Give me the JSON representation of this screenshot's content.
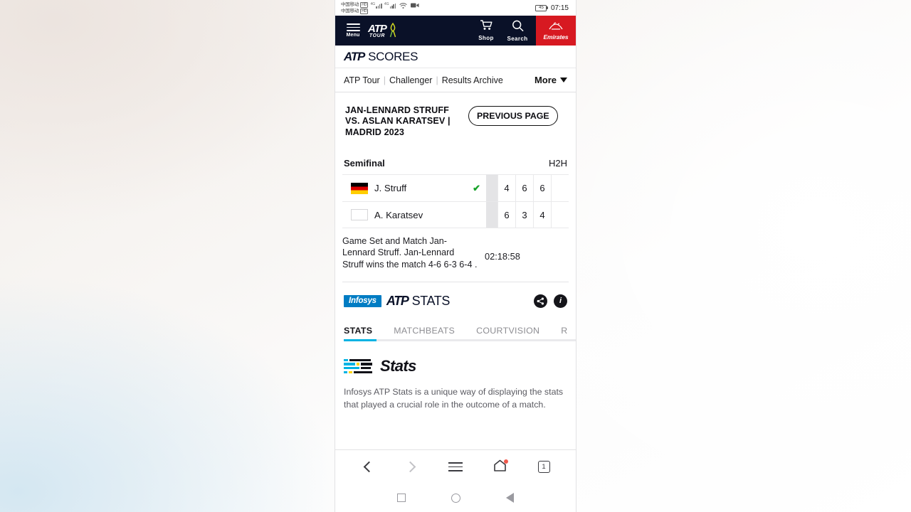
{
  "status_bar": {
    "carrier_line1": "中国移动",
    "carrier_line2": "中国移动",
    "hd_badge_1": "HD",
    "hd_badge_2": "HD",
    "network_1": "4G",
    "network_2": "4G",
    "wifi_icon": "wifi-icon",
    "video_icon": "video-camera-icon",
    "battery_level": "45",
    "clock": "07:15"
  },
  "top_nav": {
    "menu_label": "Menu",
    "logo_main": "ATP",
    "logo_sub": "TOUR",
    "ribbon_icon": "ribbon-icon",
    "shop_label": "Shop",
    "shop_icon": "cart-icon",
    "search_label": "Search",
    "search_icon": "search-icon",
    "sponsor_label": "Emirates",
    "sponsor_arabic": "طيران",
    "sponsor_color": "#d71921",
    "nav_bg": "#0a1128"
  },
  "scores_header": {
    "brand": "ATP",
    "title": "SCORES"
  },
  "sub_nav": {
    "items": [
      {
        "label": "ATP Tour"
      },
      {
        "label": "Challenger"
      },
      {
        "label": "Results Archive"
      }
    ],
    "separator": "|",
    "more_label": "More",
    "more_icon": "chevron-down-icon"
  },
  "match_header": {
    "title": "JAN-LENNARD STRUFF VS. ASLAN KARATSEV | MADRID 2023",
    "previous_page_label": "PREVIOUS PAGE"
  },
  "scoreboard": {
    "round": "Semifinal",
    "h2h_label": "H2H",
    "players": [
      {
        "flag": "germany-flag",
        "flag_class": "de",
        "name": "J. Struff",
        "winner": true,
        "winner_icon": "check-icon",
        "winner_color": "#18a32a",
        "sets": [
          "4",
          "6",
          "6",
          ""
        ]
      },
      {
        "flag": "neutral-flag",
        "flag_class": "blank",
        "name": "A. Karatsev",
        "winner": false,
        "winner_icon": "",
        "winner_color": "",
        "sets": [
          "6",
          "3",
          "4",
          ""
        ]
      }
    ]
  },
  "summary": {
    "text": "Game Set and Match Jan-Lennard Struff. Jan-Lennard Struff wins the match 4-6 6-3 6-4 .",
    "duration": "02:18:58"
  },
  "stats_header": {
    "sponsor": "Infosys",
    "sponsor_color": "#007cc3",
    "brand": "ATP",
    "title": "STATS",
    "share_icon": "share-icon",
    "info_icon": "info-icon"
  },
  "stats_tabs": {
    "items": [
      {
        "label": "STATS",
        "active": true
      },
      {
        "label": "MATCHBEATS",
        "active": false
      },
      {
        "label": "COURTVISION",
        "active": false
      },
      {
        "label": "R",
        "active": false
      }
    ],
    "active_underline_color": "#00b3e3"
  },
  "stats_body": {
    "logo_icon": "stats-bars-icon",
    "logo_word": "Stats",
    "logo_colors": [
      "#00b3e3",
      "#ffd200",
      "#111118"
    ],
    "description": "Infosys ATP Stats is a unique way of displaying the stats that played a crucial role in the outcome of a match."
  },
  "browser_nav": {
    "back_icon": "chevron-left-icon",
    "forward_icon": "chevron-right-icon",
    "menu_icon": "hamburger-icon",
    "home_icon": "home-icon",
    "home_badge": true,
    "tab_count": "1"
  },
  "system_nav": {
    "recents_icon": "square-icon",
    "home_icon": "circle-icon",
    "back_icon": "triangle-back-icon"
  }
}
